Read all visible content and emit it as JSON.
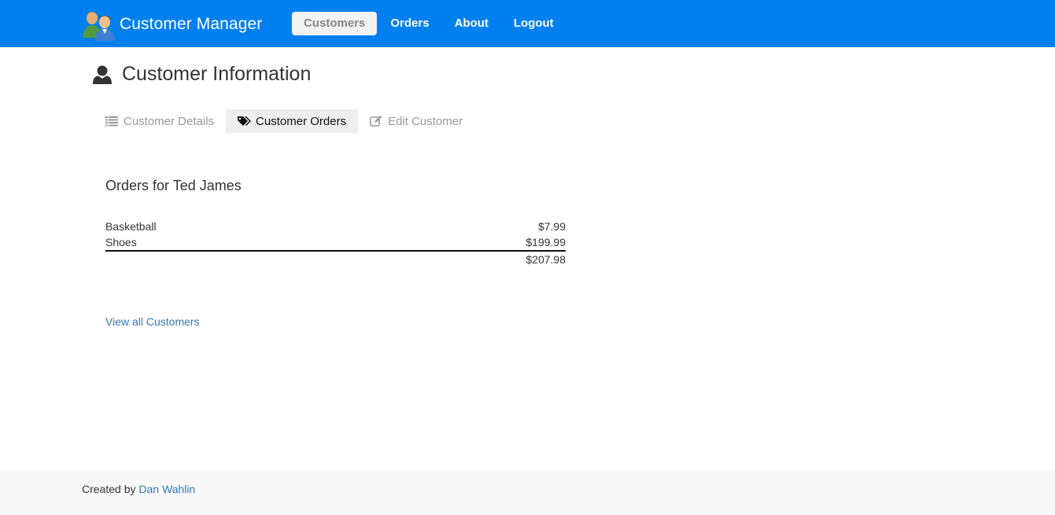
{
  "header": {
    "brand": "Customer Manager",
    "nav": [
      {
        "label": "Customers",
        "active": true
      },
      {
        "label": "Orders",
        "active": false
      },
      {
        "label": "About",
        "active": false
      },
      {
        "label": "Logout",
        "active": false
      }
    ],
    "accent_color": "#0080f0"
  },
  "page": {
    "title": "Customer Information",
    "title_icon": "user-icon"
  },
  "tabs": [
    {
      "label": "Customer Details",
      "icon": "list-icon",
      "active": false
    },
    {
      "label": "Customer Orders",
      "icon": "tags-icon",
      "active": true
    },
    {
      "label": "Edit Customer",
      "icon": "edit-icon",
      "active": false
    }
  ],
  "orders": {
    "heading": "Orders for Ted James",
    "items": [
      {
        "product": "Basketball",
        "price": "$7.99"
      },
      {
        "product": "Shoes",
        "price": "$199.99"
      }
    ],
    "total": "$207.98"
  },
  "links": {
    "view_all": "View all Customers"
  },
  "footer": {
    "prefix": "Created by",
    "author": "Dan Wahlin",
    "background": "#f8f8f8"
  }
}
